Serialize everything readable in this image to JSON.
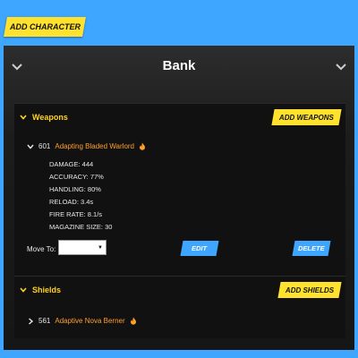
{
  "top": {
    "add_character": "ADD CHARACTER"
  },
  "bank": {
    "title": "Bank",
    "weapons": {
      "title": "Weapons",
      "add_label": "ADD WEAPONS",
      "item": {
        "id": "601",
        "name": "Adapting Bladed Warlord",
        "stats": [
          "DAMAGE: 444",
          "ACCURACY: 77%",
          "HANDLING: 80%",
          "RELOAD: 3.4s",
          "FIRE RATE: 8.1/s",
          "MAGAZINE SIZE: 30"
        ],
        "move_to_label": "Move To:",
        "move_to_value": "",
        "edit_label": "EDIT",
        "delete_label": "DELETE"
      }
    },
    "shields": {
      "title": "Shields",
      "add_label": "ADD SHIELDS",
      "item": {
        "id": "561",
        "name": "Adaptive Nova Berner"
      }
    }
  },
  "colors": {
    "background": "#3fa6ff",
    "accent_yellow": "#ffe22d",
    "item_orange": "#ff9f2e",
    "panel_dark": "#111111"
  },
  "icons": {
    "collapse": "chevron-down-icon",
    "expand": "chevron-right-icon",
    "rarity": "flame-icon"
  }
}
